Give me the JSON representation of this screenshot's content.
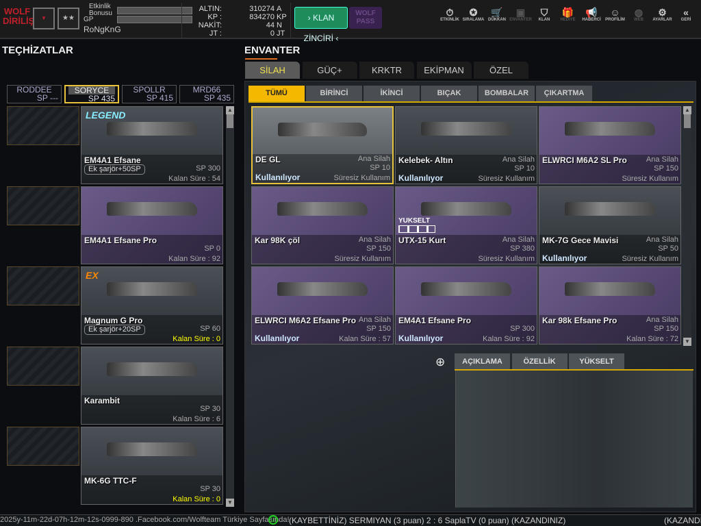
{
  "topbar": {
    "logo": "WOLF DİRİLİŞ",
    "event_bonus_label": "Etkinlik Bonusu",
    "gp_label": "GP",
    "username": "RoNgKnG",
    "currencies": [
      {
        "label": "ALTIN:",
        "value": "310274",
        "unit": "A"
      },
      {
        "label": "KP :",
        "value": "834270",
        "unit": "KP"
      },
      {
        "label": "NAKİT:",
        "value": "44",
        "unit": "N"
      },
      {
        "label": "JT :",
        "value": "0",
        "unit": "JT"
      }
    ],
    "klan_button": "› KLAN ZİNCİRİ ‹",
    "wolf_pass": "WOLF PASS",
    "nav": [
      {
        "label": "ETKİNLİK",
        "icon": "⏱"
      },
      {
        "label": "SIRALAMA",
        "icon": "✪"
      },
      {
        "label": "DÜKKAN",
        "icon": "🛒"
      },
      {
        "label": "ENVANTER",
        "icon": "▣",
        "dim": true
      },
      {
        "label": "KLAN",
        "icon": "⛉"
      },
      {
        "label": "HEDİYE",
        "icon": "🎁",
        "dim": true
      },
      {
        "label": "HABERCİ",
        "icon": "📢"
      },
      {
        "label": "PROFİLİM",
        "icon": "☺"
      },
      {
        "label": "WEB",
        "icon": "◍",
        "dim": true
      },
      {
        "label": "AYARLAR",
        "icon": "⚙"
      },
      {
        "label": "GERİ",
        "icon": "«"
      }
    ]
  },
  "left": {
    "title": "TEÇHİZATLAR",
    "tabs": [
      {
        "name": "RODDEE",
        "sp": "SP ---"
      },
      {
        "name": "SORYCE",
        "sp": "SP 435"
      },
      {
        "name": "SPOLLR",
        "sp": "SP 415"
      },
      {
        "name": "MRD66",
        "sp": "SP 435"
      }
    ],
    "items": [
      {
        "name": "EM4A1 Efsane",
        "extra": "Ek şarjör+50SP",
        "sp": "SP 300",
        "duration": "Kalan Süre : 54",
        "badge": "LEGEND",
        "style": "dark"
      },
      {
        "name": "EM4A1 Efsane Pro",
        "sp": "SP 0",
        "duration": "Kalan Süre : 92",
        "style": "purple"
      },
      {
        "name": "Magnum G Pro",
        "extra": "Ek şarjör+20SP",
        "sp": "SP 60",
        "duration": "Kalan Süre : 0",
        "badge": "EX",
        "style": "dark",
        "expired": true
      },
      {
        "name": "Karambit",
        "sp": "SP 30",
        "duration": "Kalan Süre : 6",
        "style": "dark"
      },
      {
        "name": "MK-6G TTC-F",
        "sp": "SP 30",
        "duration": "Kalan Süre : 0",
        "style": "dark",
        "expired": true
      }
    ]
  },
  "inventory": {
    "title": "ENVANTER",
    "tabs": [
      "SİLAH",
      "GÜÇ+",
      "KRKTR",
      "EKİPMAN",
      "ÖZEL"
    ],
    "subtabs": [
      "TÜMÜ",
      "BİRİNCİ",
      "İKİNCİ",
      "BIÇAK",
      "BOMBALAR",
      "ÇIKARTMA"
    ],
    "items": [
      {
        "name": "DE GL",
        "type": "Ana Silah",
        "sp": "SP 10",
        "duration": "Süresiz Kullanım",
        "status": "Kullanılıyor",
        "style": "grey",
        "selected": true
      },
      {
        "name": "Kelebek- Altın",
        "type": "Ana Silah",
        "sp": "SP 10",
        "duration": "Süresiz Kullanım",
        "status": "Kullanılıyor",
        "style": "dark"
      },
      {
        "name": "ELWRCI M6A2 SL Pro",
        "type": "Ana Silah",
        "sp": "SP 150",
        "duration": "Süresiz Kullanım",
        "style": "purple"
      },
      {
        "name": "Kar 98K çöl",
        "type": "Ana Silah",
        "sp": "SP 150",
        "duration": "Süresiz Kullanım",
        "style": "purple"
      },
      {
        "name": "UTX-15 Kurt",
        "type": "Ana Silah",
        "sp": "SP 380",
        "duration": "Süresiz Kullanım",
        "style": "purple",
        "upgrade": "YUKSELT"
      },
      {
        "name": "MK-7G Gece Mavisi",
        "type": "Ana Silah",
        "sp": "SP 50",
        "duration": "Süresiz Kullanım",
        "status": "Kullanılıyor",
        "style": "dark"
      },
      {
        "name": "ELWRCI M6A2 Efsane Pro",
        "type": "Ana Silah",
        "sp": "SP 150",
        "duration": "Kalan Süre : 57",
        "status": "Kullanılıyor",
        "style": "purple"
      },
      {
        "name": "EM4A1 Efsane Pro",
        "sp": "SP 300",
        "duration": "Kalan Süre : 92",
        "status": "Kullanılıyor",
        "style": "purple"
      },
      {
        "name": "Kar 98k Efsane Pro",
        "type": "Ana Silah",
        "sp": "SP 150",
        "duration": "Kalan Süre : 72",
        "style": "purple"
      }
    ]
  },
  "details": {
    "tabs": [
      "AÇIKLAMA",
      "ÖZELLİK",
      "YÜKSELT"
    ]
  },
  "ticker": {
    "left": "2025y-11m-22d-07h-12m-12s-0999-890  .Facebook.com/Wolfteam Türkiye Sayfasında!",
    "message": "(KAYBETTİNİZ) SERMIYAN (3 puan) 2 : 6 SaplaTV (0 puan) (KAZANDINIZ)",
    "right": "(KAZANDINIZ)"
  }
}
